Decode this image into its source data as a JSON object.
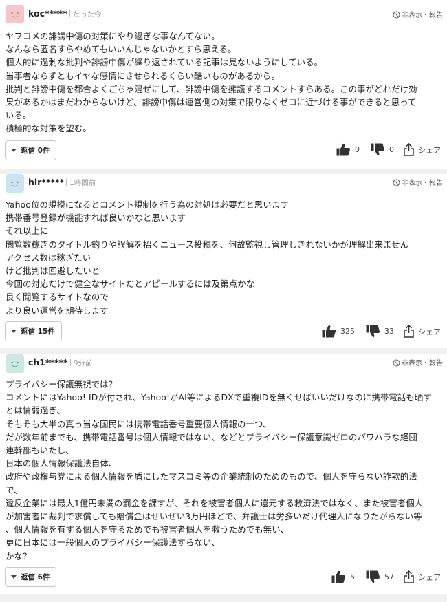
{
  "comments": [
    {
      "username": "koc*****",
      "time": "たった今",
      "report_label": "非表示・報告",
      "avatar_color": "#f3c7c9",
      "avatar_face": "#e0868c",
      "lines": [
        "ヤフコメの誹謗中傷の対策にやり過ぎな事なんてない。",
        "なんなら匿名すらやめてもいいんじゃないかとすら思える。",
        "個人的に過剰な批判や誹謗中傷が繰り返されている記事は見ないようにしている。",
        "当事者ならずともイヤな感情にさせられるくらい酷いものがあるから。",
        "批判と誹謗中傷を都合よくごちゃ混ぜにして、誹謗中傷を擁護するコメントすらある。この事がどれだけ効",
        "果があるかはまだわからないけど、誹謗中傷は運営側の対策で限りなくゼロに近づける事ができると思って",
        "いる。",
        "積極的な対策を望む。"
      ],
      "reply_label": "返信 0件",
      "likes": "0",
      "dislikes": "0",
      "share_label": "シェア"
    },
    {
      "username": "hir*****",
      "time": "1時間前",
      "report_label": "非表示・報告",
      "avatar_color": "#cde3f1",
      "avatar_face": "#6fa8cf",
      "lines": [
        "Yahoo位の規模になるとコメント規制を行う為の対処は必要だと思います",
        "携帯番号登録が機能すれば良いかなと思います",
        "それ以上に",
        "閲覧数稼ぎのタイトル釣りや誤解を招くニュース投稿を、何故監視し管理しきれないかが理解出来ません",
        "アクセス数は稼ぎたい",
        "けど批判は回避したいと",
        "今回の対応だけで健全なサイトだとアピールするには及第点かな",
        "良く閲覧するサイトなので",
        "より良い運営を期待します"
      ],
      "reply_label": "返信 15件",
      "likes": "325",
      "dislikes": "33",
      "share_label": "シェア"
    },
    {
      "username": "ch1*****",
      "time": "9分前",
      "report_label": "非表示・報告",
      "avatar_color": "#cfe7e1",
      "avatar_face": "#65b0a3",
      "lines": [
        "プライバシー保護無視では？",
        "コメントにはYahoo! IDが付され、Yahoo!がAI等によるDXで重複IDを無くせばいいだけなのに携帯電話も晒す",
        "とは情弱過ぎ、",
        "そもそも大半の真っ当な国民には携帯電話番号重要個人情報の一つ、",
        "だが数年前までも、携帯電話番号は個人情報ではない、などとプライバシー保護意識ゼロのパワハラな経団",
        "連幹部もいたし、",
        "日本の個人情報保護法自体、",
        "政府や政権与党による個人情報を盾にしたマスコミ等の企業統制のためのもので、個人を守らない詐欺的法",
        "で、",
        "違反企業には最大1億円未満の罰金を課すが、それを被害者個人に還元する救済法ではなく、また被害者個人",
        "が加害者に裁判で求償しても賠償金はせいぜい3万円ほどで、弁護士は労多いだけ代理人になりたがらない等",
        "、個人情報を有する個人を守るためでも被害者個人を救うためでも無い、",
        "更に日本には一般個人のプライバシー保護法すらない、",
        "かな？"
      ],
      "reply_label": "返信 6件",
      "likes": "5",
      "dislikes": "57",
      "share_label": "シェア"
    }
  ]
}
